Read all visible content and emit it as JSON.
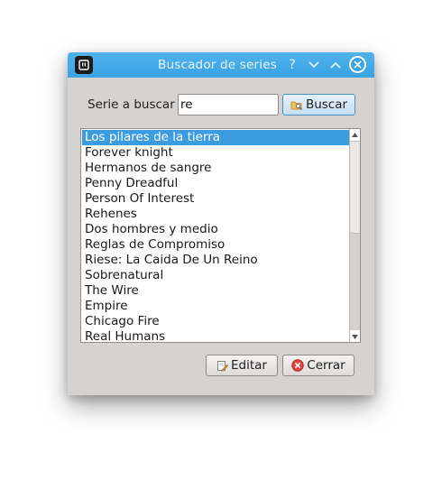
{
  "window": {
    "title": "Buscador de series",
    "help_glyph": "?",
    "minimize_glyph": "⌄",
    "maximize_glyph": "⌃",
    "close_icon": "close-icon"
  },
  "search": {
    "label": "Serie a buscar",
    "value": "re",
    "button_label": "Buscar"
  },
  "results": {
    "items": [
      "Los pilares de la tierra",
      "Forever knight",
      "Hermanos de sangre",
      "Penny Dreadful",
      "Person Of Interest",
      "Rehenes",
      "Dos hombres y medio",
      "Reglas de Compromiso",
      "Riese: La Caida De Un Reino",
      "Sobrenatural",
      "The Wire",
      "Empire",
      "Chicago Fire",
      "Real Humans"
    ],
    "selected_index": 0
  },
  "actions": {
    "edit_label": "Editar",
    "close_label": "Cerrar"
  },
  "colors": {
    "titlebar": "#3aa3e3",
    "selection": "#3d9be0",
    "window_bg": "#d6d2d0",
    "close_button": "#e04040"
  }
}
